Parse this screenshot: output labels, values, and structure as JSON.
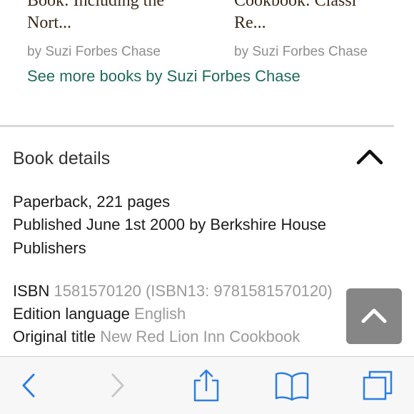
{
  "books": [
    {
      "title_line1": "Book: Including the",
      "title_line2": "Nort...",
      "author": "by Suzi Forbes Chase"
    },
    {
      "title_line1": "Cookbook: Classi",
      "title_line2": "Re...",
      "author": "by Suzi Forbes Chase"
    }
  ],
  "see_more": "See more books by Suzi Forbes Chase",
  "details": {
    "header": "Book details",
    "format": "Paperback, 221 pages",
    "published_line1": "Published June 1st 2000 by Berkshire House",
    "published_line2": "Publishers",
    "isbn_label": "ISBN",
    "isbn_value": "1581570120 (ISBN13: 9781581570120)",
    "language_label": "Edition language",
    "language_value": "English",
    "original_title_label": "Original title",
    "original_title_value": "New Red Lion Inn Cookbook"
  },
  "toolbar": {
    "icons": [
      "back-icon",
      "forward-icon",
      "share-icon",
      "bookmarks-icon",
      "tabs-icon"
    ]
  },
  "colors": {
    "link": "#1f6b5a",
    "toolbar_icon": "#2d7ee2",
    "toolbar_icon_disabled": "#c8c8c8"
  }
}
